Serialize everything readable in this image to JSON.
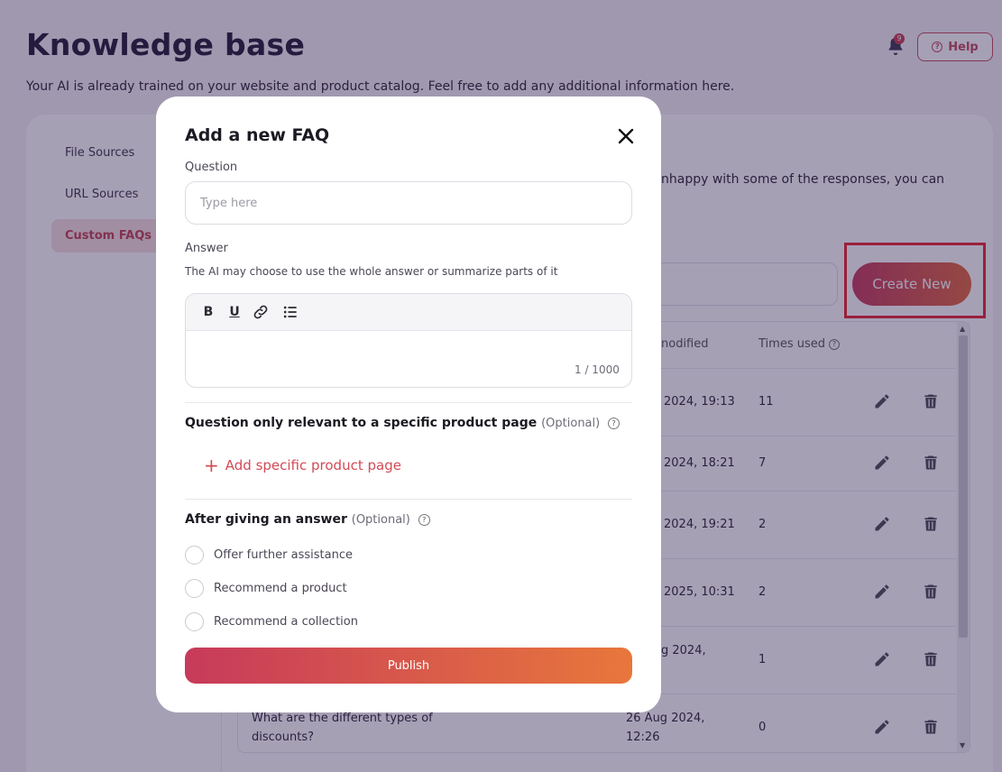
{
  "page": {
    "title": "Knowledge base",
    "subtitle": "Your AI is already trained on your website and product catalog. Feel free to add any additional information here.",
    "notification_count": "9",
    "help_label": "Help"
  },
  "sidebar": {
    "items": [
      {
        "label": "File Sources"
      },
      {
        "label": "URL Sources"
      },
      {
        "label": "Custom FAQs"
      }
    ]
  },
  "main": {
    "description_fragment": "nhappy with some of the responses, you can",
    "create_new_label": "Create New",
    "columns": [
      "nodified",
      "Times used"
    ],
    "rows": [
      {
        "question": "",
        "modified": "2024, 19:13",
        "times_used": "11"
      },
      {
        "question": "",
        "modified": "2024, 18:21",
        "times_used": "7"
      },
      {
        "question": "",
        "modified": "2024, 19:21",
        "times_used": "2"
      },
      {
        "question": "",
        "modified": "2025, 10:31",
        "times_used": "2"
      },
      {
        "question": "",
        "modified": "g 2024,",
        "times_used": "1"
      },
      {
        "question_line1": "What are the different types of",
        "question_line2": "discounts?",
        "modified_line1": "26 Aug 2024,",
        "modified_line2": "12:26",
        "times_used": "0"
      }
    ]
  },
  "modal": {
    "title": "Add a new FAQ",
    "question_label": "Question",
    "question_placeholder": "Type here",
    "question_value": "",
    "answer_label": "Answer",
    "answer_hint": "The AI may choose to use the whole answer or summarize parts of it",
    "toolbar": {
      "bold": "B",
      "underline": "U"
    },
    "answer_value": "",
    "char_counter": "1 / 1000",
    "product_section_title": "Question only relevant to a specific product page",
    "optional_label": "(Optional)",
    "add_product_label": "Add specific product page",
    "after_answer_title": "After giving an answer",
    "options": [
      {
        "label": "Offer further assistance"
      },
      {
        "label": "Recommend a product"
      },
      {
        "label": "Recommend a collection"
      }
    ],
    "publish_label": "Publish"
  },
  "colors": {
    "accent": "#c1414f",
    "gradient_start": "#c73a5b",
    "gradient_end": "#e8773b",
    "highlight": "#e8242e"
  }
}
